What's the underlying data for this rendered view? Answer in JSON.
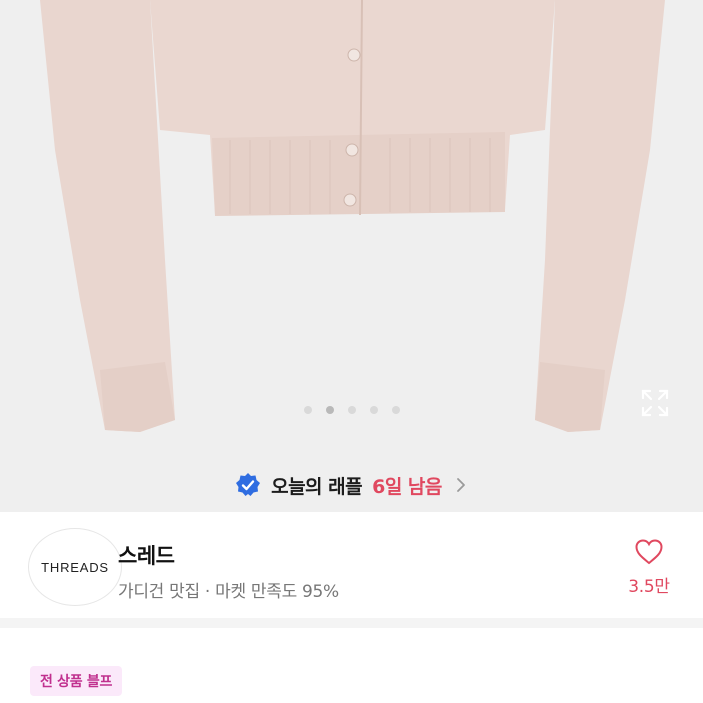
{
  "hero": {
    "slide_count": 5,
    "active_slide": 2,
    "expand_icon": "expand-icon"
  },
  "raffle": {
    "badge_icon": "verified-check-icon",
    "label": "오늘의 래플",
    "days_left": "6일 남음",
    "chevron_icon": "chevron-right-icon",
    "accent_color": "#e0485f"
  },
  "seller": {
    "avatar_text": "THREADS",
    "name": "스레드",
    "meta": "가디건 맛집 · 마켓 만족도 95%",
    "like_icon": "heart-icon",
    "like_count": "3.5만"
  },
  "promo": {
    "badge_label": "전 상품 블프",
    "badge_color": "#c0308e"
  }
}
